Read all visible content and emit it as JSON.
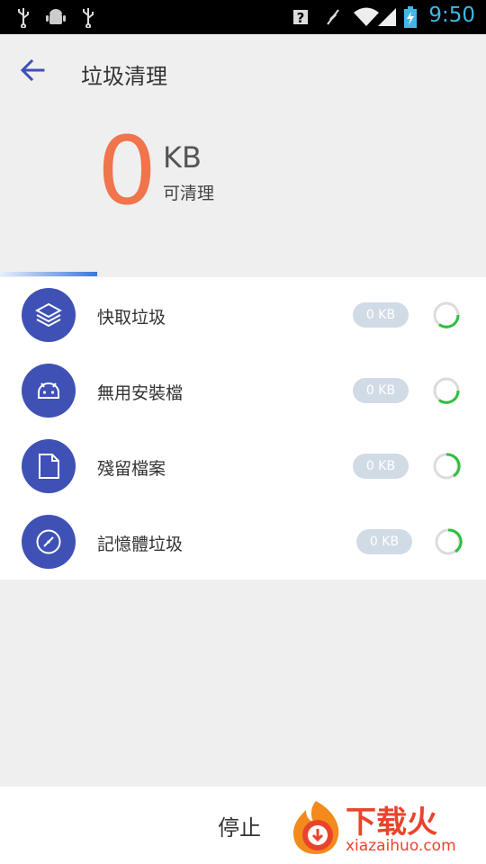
{
  "status_bar": {
    "time": "9:50",
    "left_icons": [
      "usb-icon",
      "android-debug-icon",
      "usb-icon"
    ],
    "right_icons": [
      "help-icon",
      "mute-icon",
      "wifi-icon",
      "signal-icon",
      "battery-charging-icon"
    ]
  },
  "app_bar": {
    "title": "垃圾清理",
    "back_icon": "arrow-left-icon"
  },
  "summary": {
    "amount": "0",
    "unit": "KB",
    "caption": "可清理"
  },
  "items": [
    {
      "icon": "layers-icon",
      "label": "快取垃圾",
      "size": "0 KB"
    },
    {
      "icon": "android-icon",
      "label": "無用安裝檔",
      "size": "0 KB"
    },
    {
      "icon": "file-icon",
      "label": "殘留檔案",
      "size": "0 KB"
    },
    {
      "icon": "gauge-icon",
      "label": "記憶體垃圾",
      "size": "0 KB"
    }
  ],
  "bottom": {
    "stop_label": "停止"
  },
  "watermark": {
    "text": "下载火",
    "url": "xiazaihuo.com"
  },
  "colors": {
    "accent": "#3f51b5",
    "amount": "#f0744c",
    "spinner": "#2fbf3f",
    "badge": "#d1dbe6"
  }
}
